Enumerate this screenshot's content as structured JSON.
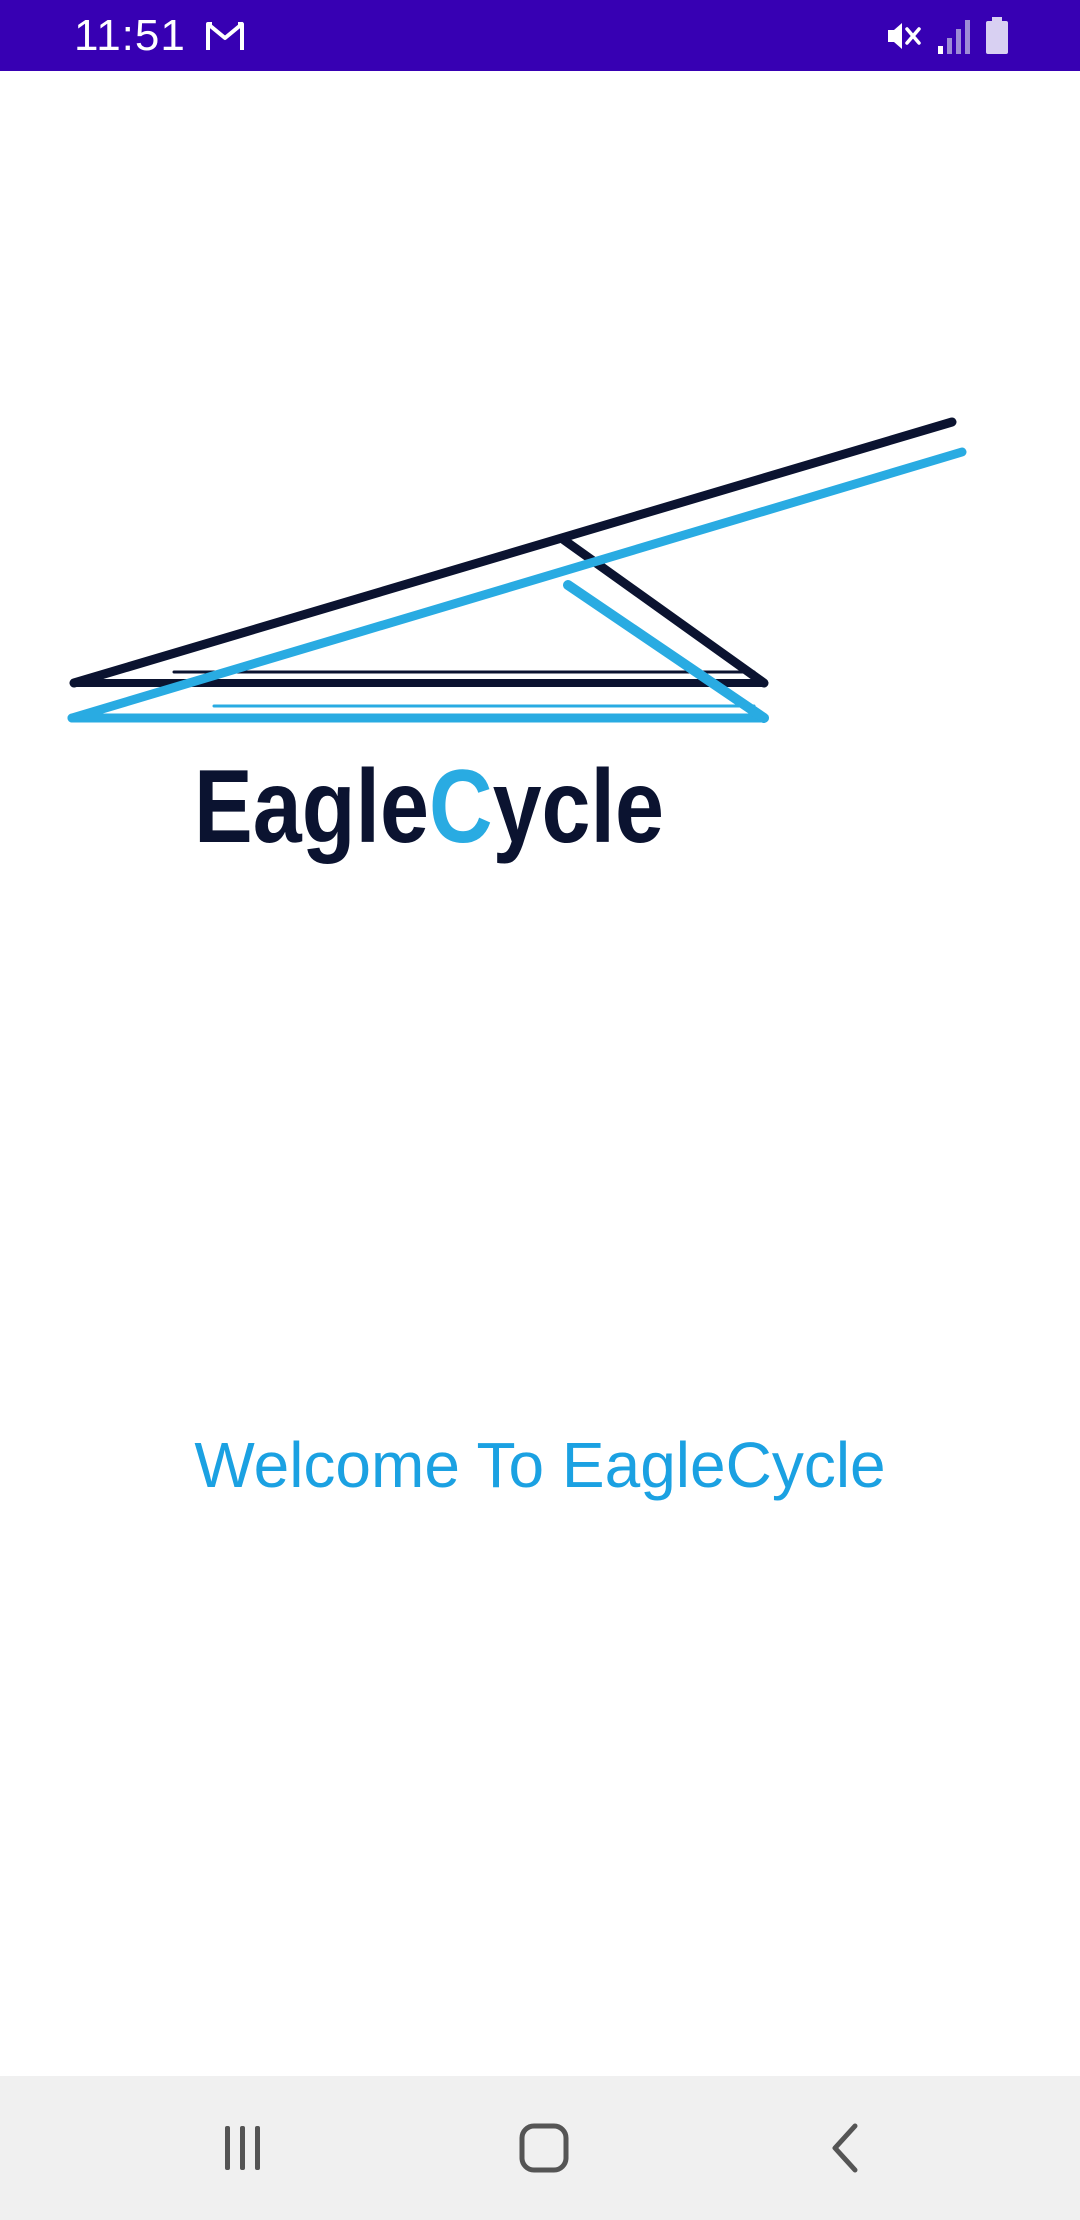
{
  "status_bar": {
    "time": "11:51",
    "background_color": "#3700b3",
    "icons": [
      "gmail-icon",
      "vibrate-mute-icon",
      "signal-icon",
      "battery-icon"
    ]
  },
  "logo": {
    "wordmark_part1": "Eagle",
    "wordmark_letter_c": "C",
    "wordmark_part2": "ycle",
    "dark_color": "#0b1330",
    "accent_color": "#29abe2"
  },
  "welcome": {
    "text": "Welcome To EagleCycle",
    "color": "#1ba1e2"
  },
  "nav_bar": {
    "buttons": [
      "recents-icon",
      "home-icon",
      "back-icon"
    ]
  }
}
